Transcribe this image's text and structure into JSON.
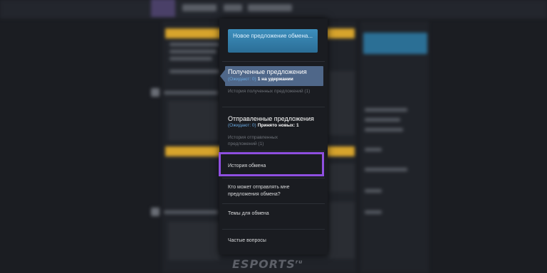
{
  "menu": {
    "new_offer_label": "Новое предложение обмена...",
    "received": {
      "title": "Полученные предложения",
      "pending_label": "(Ожидают: 0)",
      "hold_label": "1 на удержании",
      "history": "История полученных предложений (1)"
    },
    "sent": {
      "title": "Отправленные предложения",
      "pending_label": "(Ожидают: 0)",
      "accepted_label": "Принято новых: 1",
      "history": "История отправленных предложений (1)"
    },
    "trade_history": "История обмена",
    "who_can_send": "Кто может отправлять мне предложения обмена?",
    "trade_topics": "Темы для обмена",
    "faq": "Частые вопросы"
  },
  "highlight_color": "#8f4fe0",
  "watermark": {
    "text": "ESPORTS",
    "suffix": "ru"
  }
}
